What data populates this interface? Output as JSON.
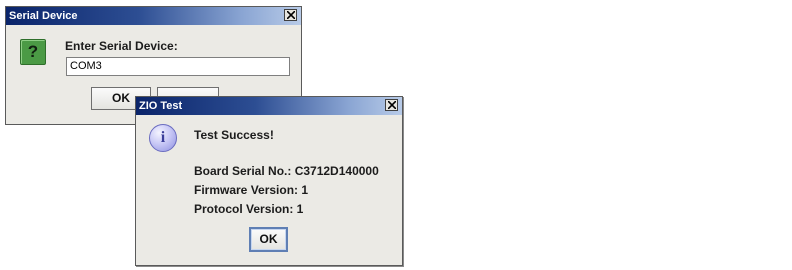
{
  "serial_dialog": {
    "title": "Serial Device",
    "prompt": "Enter Serial Device:",
    "input_value": "COM3",
    "ok_label": "OK",
    "cancel_label": "",
    "question_icon": "?"
  },
  "zio_dialog": {
    "title": "ZIO Test",
    "heading": "Test Success!",
    "board_serial": "Board Serial No.: C3712D140000",
    "firmware_version": "Firmware Version: 1",
    "protocol_version": "Protocol Version: 1",
    "ok_label": "OK",
    "info_icon": "i"
  },
  "colors": {
    "titlebar_start": "#0a246a",
    "titlebar_end": "#b8cbe8",
    "dialog_bg": "#ebeae5",
    "question_icon_bg": "#4b9a45",
    "info_icon_bg": "#b8b9f0"
  }
}
